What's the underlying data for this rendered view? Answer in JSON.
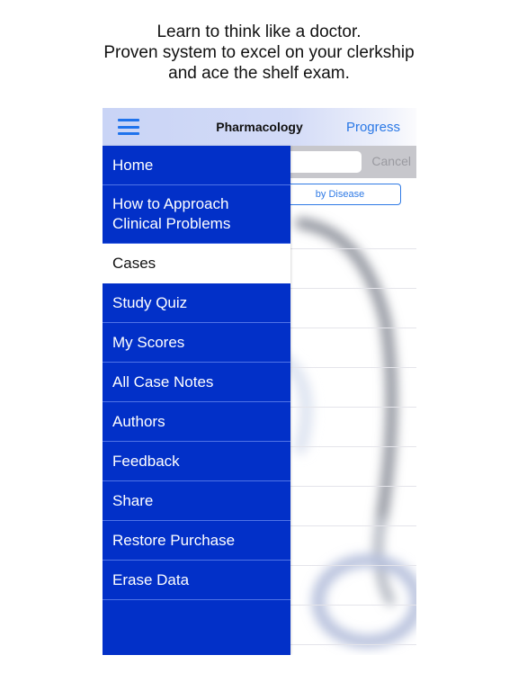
{
  "tagline": {
    "line1": "Learn to think like a doctor.",
    "line2": "Proven system to excel on your clerkship",
    "line3": "and ace the shelf exam."
  },
  "navbar": {
    "menu_icon": "hamburger-menu-icon",
    "title": "Pharmacology",
    "right_button": "Progress"
  },
  "search": {
    "placeholder": "",
    "cancel_label": "Cancel"
  },
  "segment": {
    "label": "by Disease"
  },
  "menu": {
    "items": [
      {
        "label": "Home",
        "active": false
      },
      {
        "label": "How to Approach Clinical Problems",
        "line1": "How to Approach",
        "line2": "Clinical Problems",
        "active": false
      },
      {
        "label": "Cases",
        "active": true
      },
      {
        "label": "Study Quiz",
        "active": false
      },
      {
        "label": "My Scores",
        "active": false
      },
      {
        "label": "All Case Notes",
        "active": false
      },
      {
        "label": "Authors",
        "active": false
      },
      {
        "label": "Feedback",
        "active": false
      },
      {
        "label": "Share",
        "active": false
      },
      {
        "label": "Restore Purchase",
        "active": false
      },
      {
        "label": "Erase Data",
        "active": false
      }
    ]
  },
  "colors": {
    "menu_bg": "#0230c8",
    "active_item_bg": "#ffffff",
    "accent": "#2a78e6"
  }
}
